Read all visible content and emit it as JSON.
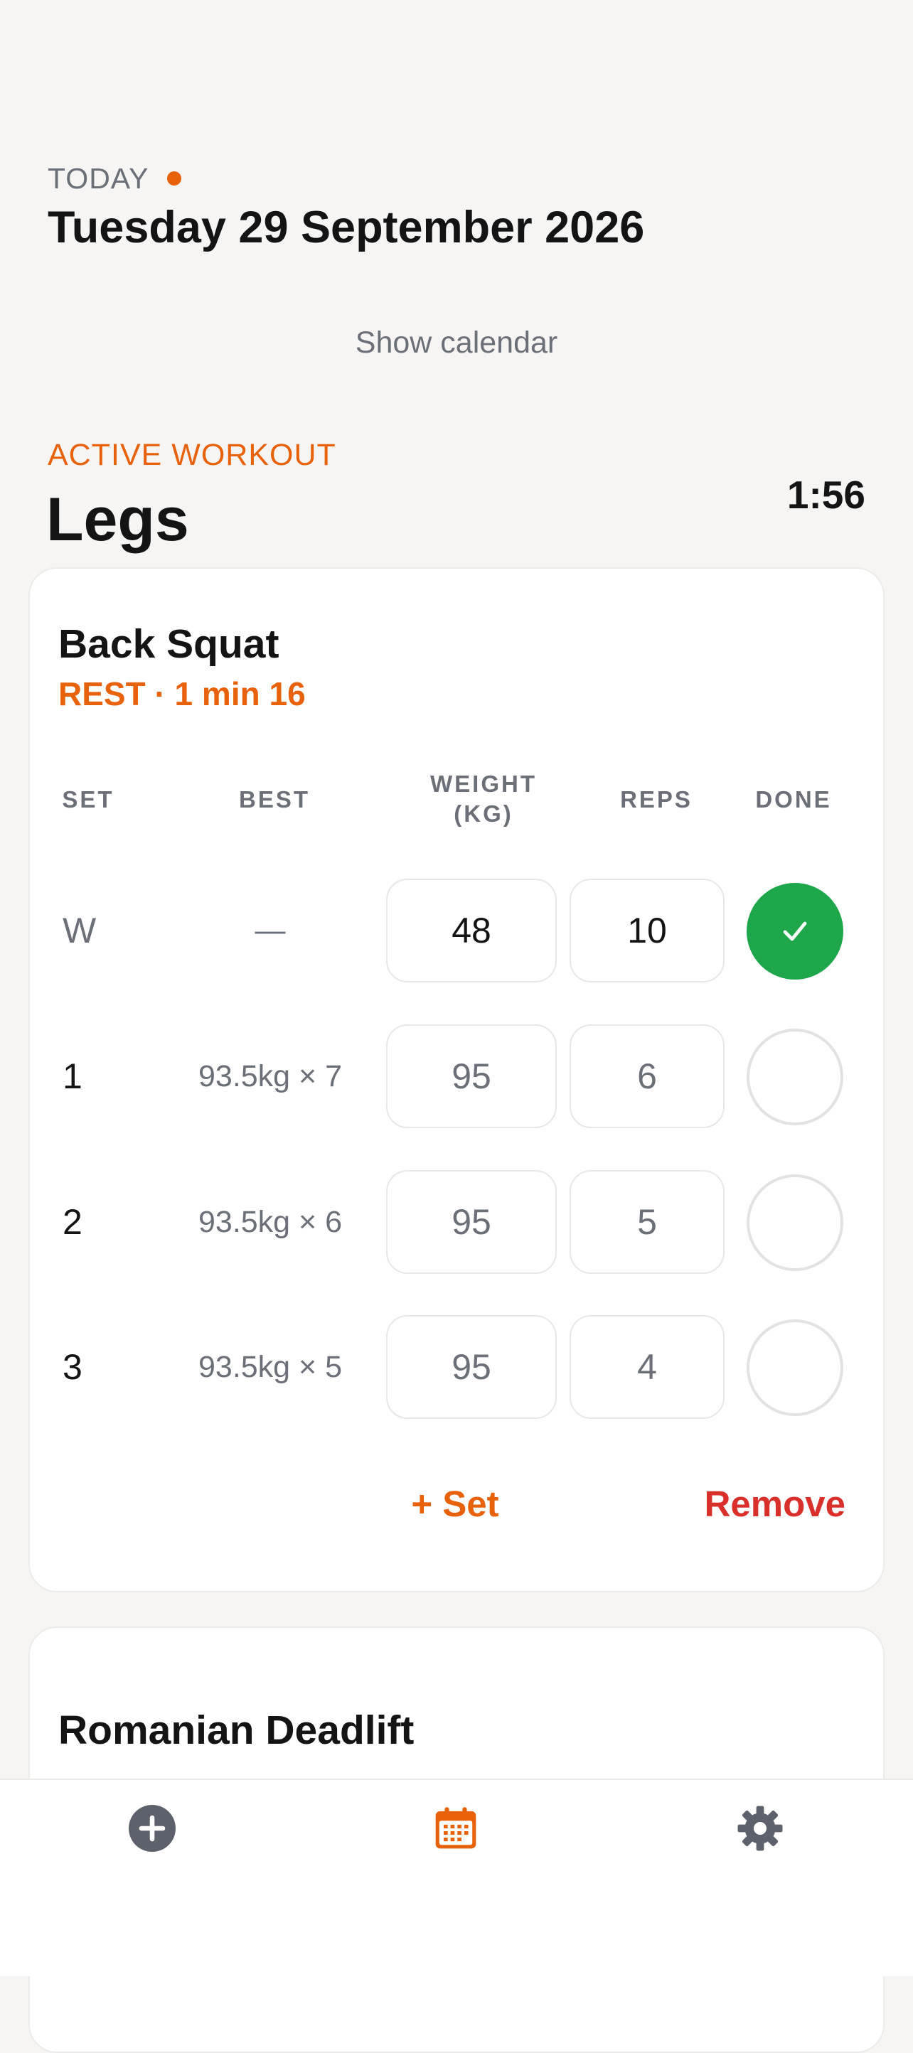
{
  "header": {
    "today_label": "TODAY",
    "date": "Tuesday 29 September 2026",
    "show_calendar": "Show calendar"
  },
  "workout": {
    "active_label": "ACTIVE WORKOUT",
    "name": "Legs",
    "timer": "1:56"
  },
  "exercise": {
    "title": "Back Squat",
    "rest": "REST · 1 min 16",
    "columns": {
      "set": "SET",
      "best": "BEST",
      "weight": "WEIGHT\n(KG)",
      "reps": "REPS",
      "done": "DONE"
    },
    "sets": [
      {
        "set": "W",
        "best": "—",
        "weight": "48",
        "reps": "10",
        "done": true
      },
      {
        "set": "1",
        "best": "93.5kg × 7",
        "weight": "95",
        "reps": "6",
        "done": false
      },
      {
        "set": "2",
        "best": "93.5kg × 6",
        "weight": "95",
        "reps": "5",
        "done": false
      },
      {
        "set": "3",
        "best": "93.5kg × 5",
        "weight": "95",
        "reps": "4",
        "done": false
      }
    ],
    "add_set": "+ Set",
    "remove": "Remove"
  },
  "next_exercise": {
    "title": "Romanian Deadlift"
  },
  "tabs": [
    {
      "icon": "plus-circle-icon"
    },
    {
      "icon": "calendar-icon",
      "active": true
    },
    {
      "icon": "gear-icon"
    }
  ],
  "colors": {
    "accent": "#e8620c",
    "done": "#1ea64a",
    "danger": "#d9302b",
    "muted": "#6b6f78"
  }
}
